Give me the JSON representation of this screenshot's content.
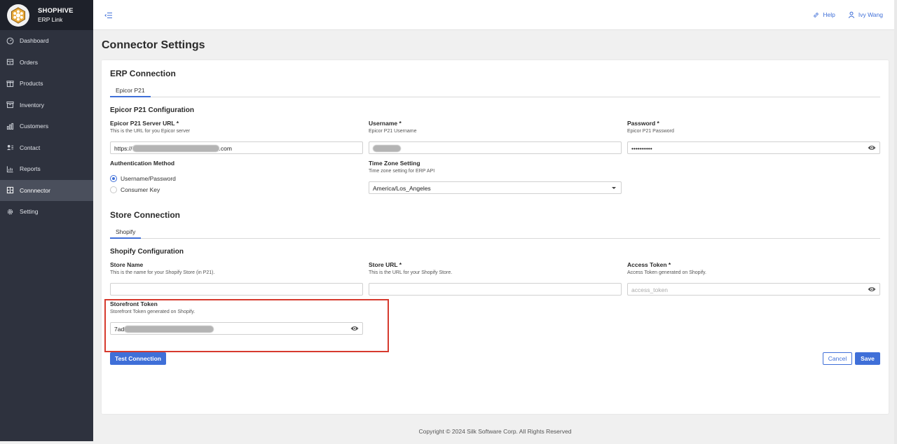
{
  "brand": {
    "name": "SHOPHIVE",
    "sub": "ERP Link"
  },
  "sidebar": {
    "items": [
      {
        "label": "Dashboard",
        "icon": "gauge-icon"
      },
      {
        "label": "Orders",
        "icon": "orders-icon"
      },
      {
        "label": "Products",
        "icon": "box-icon"
      },
      {
        "label": "Inventory",
        "icon": "archive-icon"
      },
      {
        "label": "Customers",
        "icon": "bar-chart-icon"
      },
      {
        "label": "Contact",
        "icon": "contact-card-icon"
      },
      {
        "label": "Reports",
        "icon": "chart-icon"
      },
      {
        "label": "Connnector",
        "icon": "connector-icon",
        "active": true
      },
      {
        "label": "Setting",
        "icon": "gear-icon"
      }
    ]
  },
  "topbar": {
    "help": "Help",
    "user": "Ivy Wang"
  },
  "page": {
    "title": "Connector Settings"
  },
  "erp": {
    "section_title": "ERP Connection",
    "tab": "Epicor P21",
    "config_title": "Epicor P21 Configuration",
    "server_url": {
      "label": "Epicor P21 Server URL *",
      "help": "This is the URL for you Epicor server",
      "value_prefix": "https://",
      "value_suffix": ".com"
    },
    "username": {
      "label": "Username *",
      "help": "Epicor P21 Username"
    },
    "password": {
      "label": "Password *",
      "help": "Epicor P21 Password",
      "value": "••••••••••"
    },
    "auth": {
      "label": "Authentication Method",
      "options": [
        "Username/Password",
        "Consumer Key"
      ],
      "selected": "Username/Password"
    },
    "timezone": {
      "label": "Time Zone Setting",
      "help": "Time zone setting for ERP API",
      "value": "America/Los_Angeles"
    }
  },
  "store": {
    "section_title": "Store Connection",
    "tab": "Shopify",
    "config_title": "Shopify Configuration",
    "store_name": {
      "label": "Store Name",
      "help": "This is the name for your Shopify Store (in P21)."
    },
    "store_url": {
      "label": "Store URL *",
      "help": "This is the URL for your Shopify Store."
    },
    "access_token": {
      "label": "Access Token *",
      "help": "Access Token generated on Shopify.",
      "placeholder": "access_token"
    },
    "storefront_token": {
      "label": "Storefront Token",
      "help": "Storefront Token generated on Shopify.",
      "value_prefix": "7ad"
    }
  },
  "actions": {
    "test": "Test Connection",
    "cancel": "Cancel",
    "save": "Save"
  },
  "footer": "Copyright © 2024 Silk Software Corp. All Rights Reserved",
  "colors": {
    "sidebar": "#2e323e",
    "accent": "#3f6fd8",
    "highlight": "#d63a2e"
  }
}
